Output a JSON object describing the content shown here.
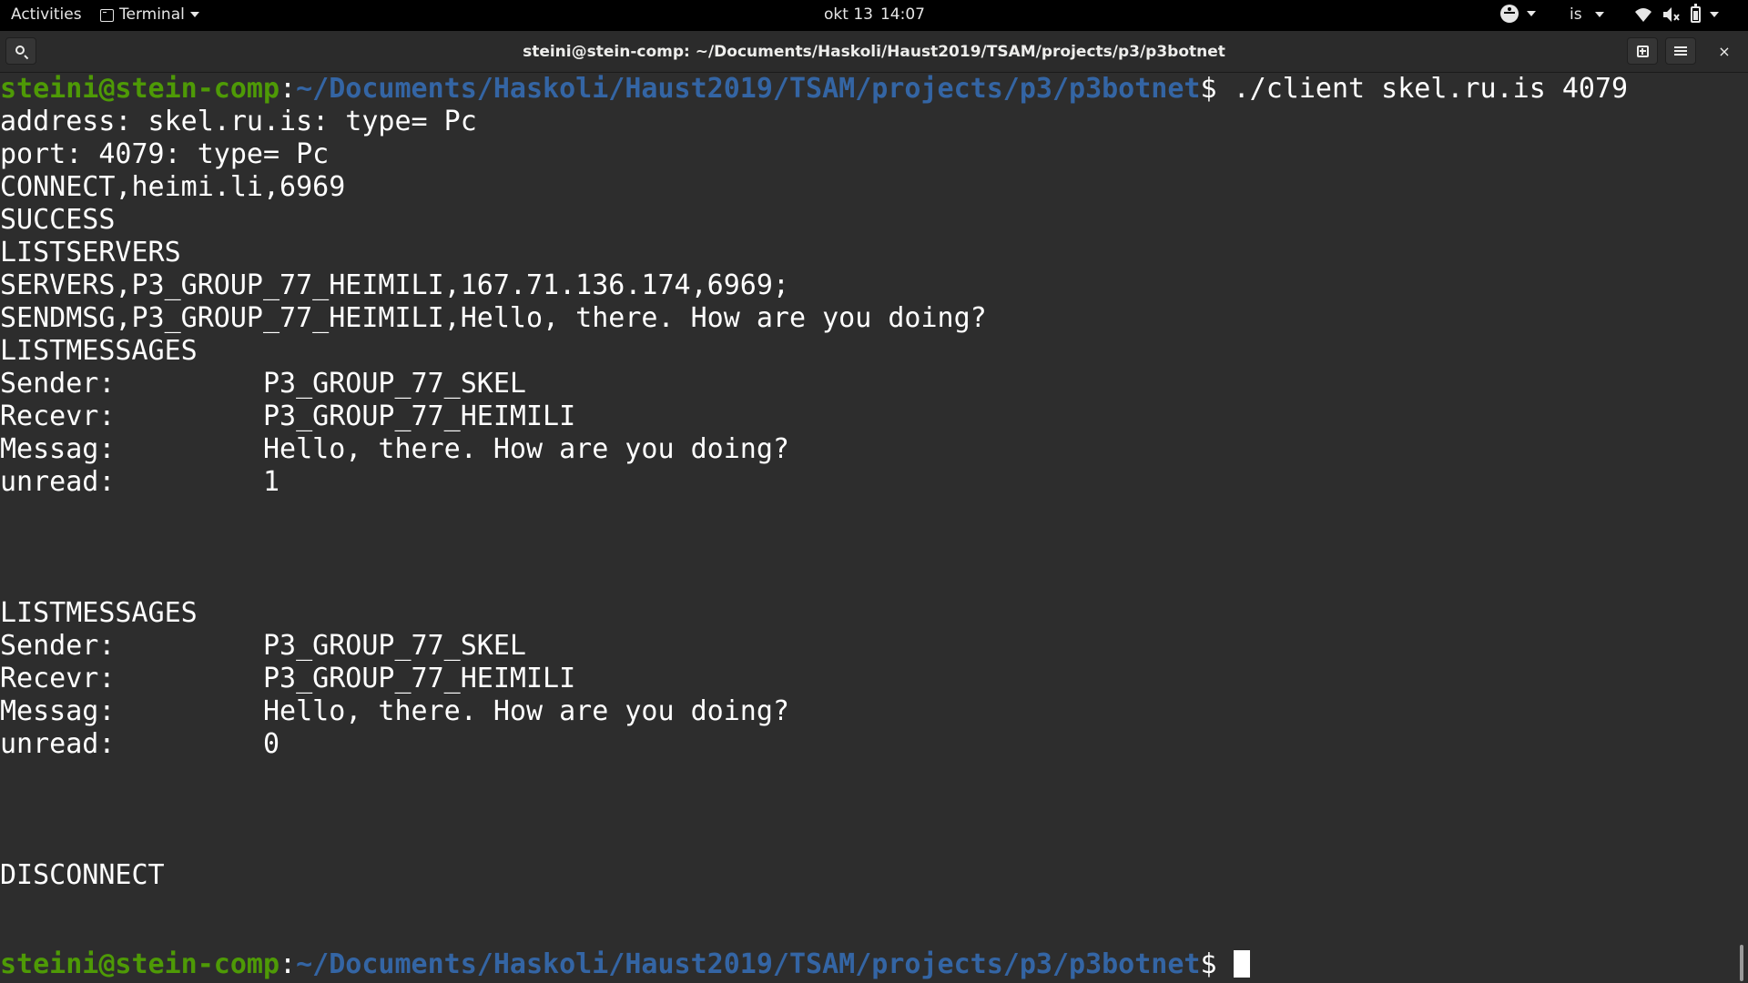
{
  "topbar": {
    "activities": "Activities",
    "app_name": "Terminal",
    "date": "okt 13",
    "time": "14:07",
    "input_source": "is"
  },
  "window": {
    "title": "steini@stein-comp: ~/Documents/Haskoli/Haust2019/TSAM/projects/p3/p3botnet",
    "close_glyph": "×"
  },
  "terminal": {
    "prompt": {
      "user_host": "steini@stein-comp",
      "separator": ":",
      "path": "~/Documents/Haskoli/Haust2019/TSAM/projects/p3/p3botnet",
      "symbol": "$ "
    },
    "command": "./client skel.ru.is 4079",
    "output": [
      "address: skel.ru.is: type= Pc",
      "port: 4079: type= Pc",
      "CONNECT,heimi.li,6969",
      "SUCCESS",
      "LISTSERVERS",
      "SERVERS,P3_GROUP_77_HEIMILI,167.71.136.174,6969;",
      "SENDMSG,P3_GROUP_77_HEIMILI,Hello, there. How are you doing?",
      "LISTMESSAGES",
      "Sender:         P3_GROUP_77_SKEL",
      "Recevr:         P3_GROUP_77_HEIMILI",
      "Messag:         Hello, there. How are you doing?",
      "unread:         1",
      "LISTMESSAGES",
      "Sender:         P3_GROUP_77_SKEL",
      "Recevr:         P3_GROUP_77_HEIMILI",
      "Messag:         Hello, there. How are you doing?",
      "unread:         0",
      "DISCONNECT"
    ]
  },
  "colors": {
    "terminal_bg": "#2d2d2d",
    "text": "#ffffff",
    "prompt_user": "#4e9a06",
    "prompt_path": "#3465a4",
    "topbar_bg": "#000000"
  }
}
